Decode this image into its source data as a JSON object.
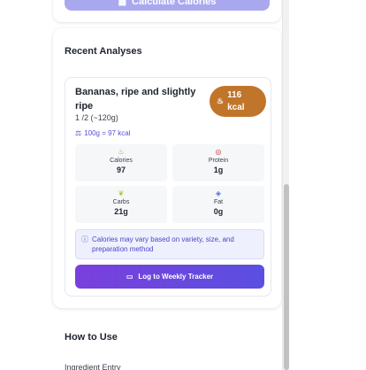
{
  "calculate_button": {
    "label": "Calculate Calories",
    "icon": "calculator-icon"
  },
  "recent": {
    "title": "Recent Analyses",
    "result": {
      "food_name": "Bananas, ripe and slightly ripe",
      "serving": "1 /2 (~120g)",
      "kcal_value": "116",
      "kcal_unit": "kcal",
      "per100": "100g = 97 kcal",
      "nutrients": [
        {
          "label": "Calories",
          "value": "97",
          "icon": "fire-icon"
        },
        {
          "label": "Protein",
          "value": "1g",
          "icon": "meat-icon"
        },
        {
          "label": "Carbs",
          "value": "21g",
          "icon": "grain-icon"
        },
        {
          "label": "Fat",
          "value": "0g",
          "icon": "droplet-icon"
        }
      ],
      "note": "Calories may vary based on variety, size, and preparation method",
      "log_button": "Log to Weekly Tracker"
    }
  },
  "how_to": {
    "title": "How to Use",
    "first_item": "Ingredient Entry"
  },
  "colors": {
    "accent": "#5a4fe0",
    "badge": "#c0752a",
    "note_bg": "#eef0fd"
  }
}
